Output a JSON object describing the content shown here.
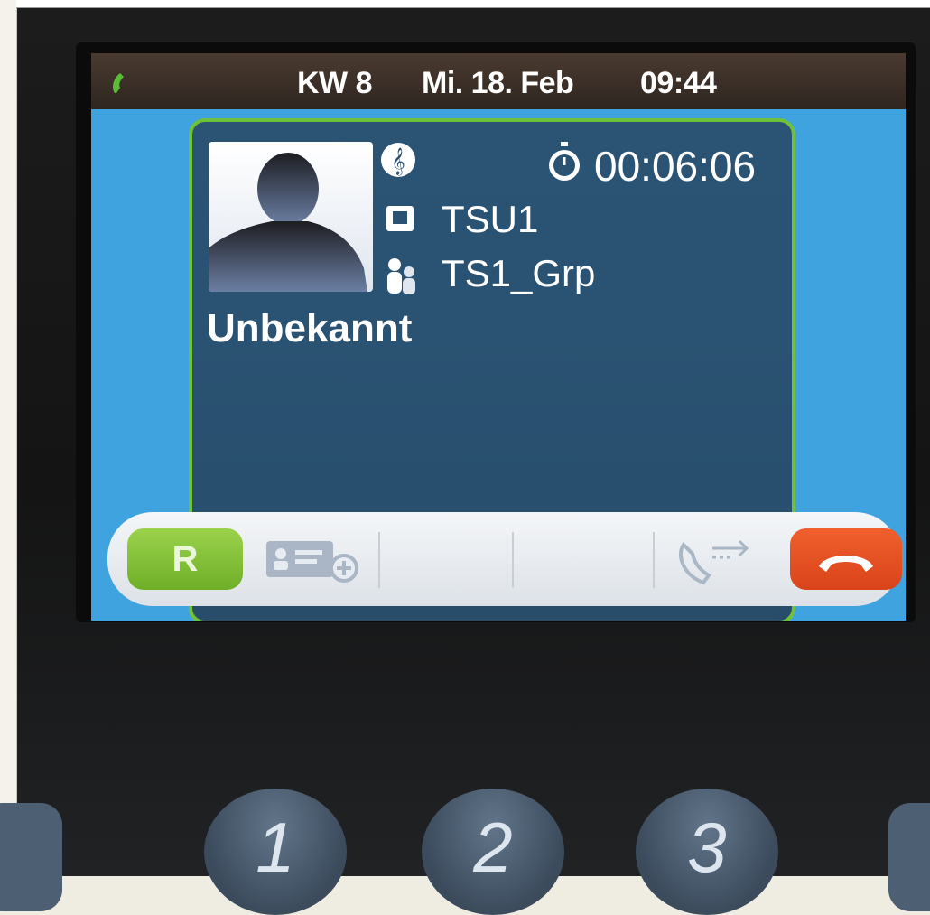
{
  "status_bar": {
    "week": "KW 8",
    "date": "Mi. 18. Feb",
    "time": "09:44",
    "icon": "phone-handset-icon"
  },
  "call": {
    "music_icon": "treble-clef-icon",
    "timer_icon": "stopwatch-icon",
    "duration": "00:06:06",
    "line_icon": "line-icon",
    "line": "TSU1",
    "group_icon": "group-icon",
    "group": "TS1_Grp",
    "caller": "Unbekannt",
    "avatar": "unknown-person-silhouette"
  },
  "softkeys": {
    "recall_label": "R",
    "contact_icon": "add-contact-icon",
    "forward_icon": "call-forward-icon",
    "hangup_icon": "hang-up-icon"
  },
  "keypad": {
    "keys": [
      "1",
      "2",
      "3"
    ]
  },
  "colors": {
    "screen_bg": "#3fa3e0",
    "card_bg": "#2a5272",
    "card_border": "#6fc03a",
    "recall_green": "#7dbd33",
    "hangup_red": "#e4501f"
  }
}
